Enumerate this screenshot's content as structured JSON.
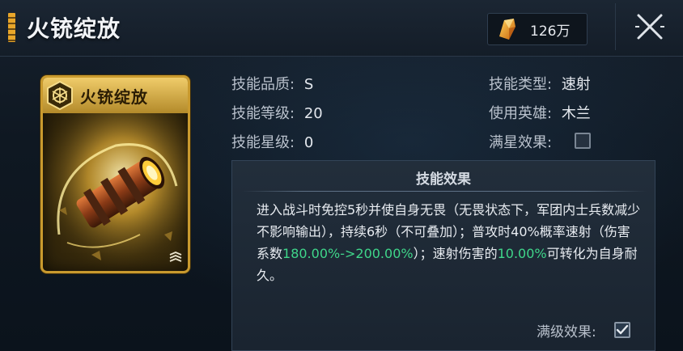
{
  "header": {
    "title": "火铳绽放",
    "currency_value": "126万",
    "currency_icon": "gold-crystal-icon",
    "close_icon": "close-icon"
  },
  "card": {
    "name": "火铳绽放",
    "emblem_icon": "hexagon-emblem-icon",
    "art": "cannon-barrel-art",
    "rank_icon": "rank-chevrons-icon"
  },
  "attributes": {
    "quality": {
      "label": "技能品质:",
      "value": "S"
    },
    "level": {
      "label": "技能等级:",
      "value": "20"
    },
    "star": {
      "label": "技能星级:",
      "value": "0"
    },
    "type": {
      "label": "技能类型:",
      "value": "速射"
    },
    "hero": {
      "label": "使用英雄:",
      "value": "木兰"
    },
    "full_star": {
      "label": "满星效果:",
      "checked": false
    }
  },
  "effect": {
    "title": "技能效果",
    "text_part1": "进入战斗时免控5秒并使自身无畏（无畏状态下，军团内士兵数减少不影响输出），持续6秒（不可叠加）；普攻时40%概率速射（伤害系数",
    "highlight1": "180.00%->200.00%",
    "text_part2": "）；速射伤害的",
    "highlight2": "10.00%",
    "text_part3": "可转化为自身耐久。",
    "max_level_label": "满级效果:",
    "max_level_checked": true
  },
  "colors": {
    "accent_gold": "#c99a2e",
    "highlight_green": "#3fd68a",
    "background": "#0d1520"
  }
}
